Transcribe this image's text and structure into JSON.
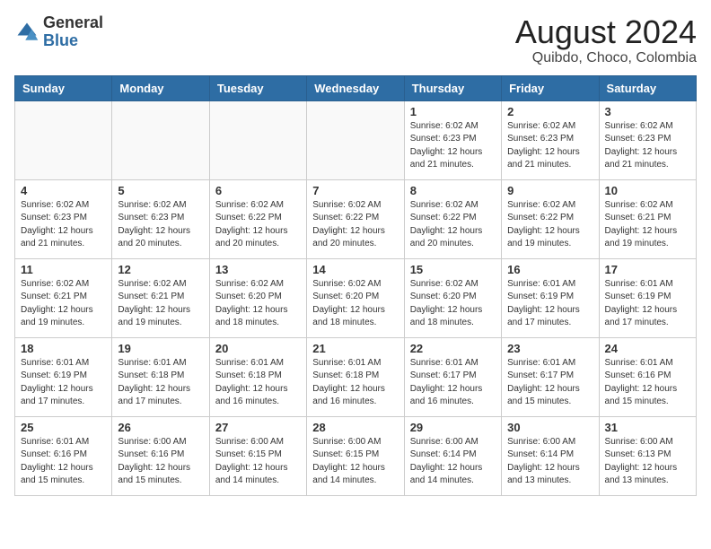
{
  "header": {
    "logo_general": "General",
    "logo_blue": "Blue",
    "month_year": "August 2024",
    "location": "Quibdo, Choco, Colombia"
  },
  "weekdays": [
    "Sunday",
    "Monday",
    "Tuesday",
    "Wednesday",
    "Thursday",
    "Friday",
    "Saturday"
  ],
  "weeks": [
    [
      {
        "day": "",
        "info": ""
      },
      {
        "day": "",
        "info": ""
      },
      {
        "day": "",
        "info": ""
      },
      {
        "day": "",
        "info": ""
      },
      {
        "day": "1",
        "info": "Sunrise: 6:02 AM\nSunset: 6:23 PM\nDaylight: 12 hours\nand 21 minutes."
      },
      {
        "day": "2",
        "info": "Sunrise: 6:02 AM\nSunset: 6:23 PM\nDaylight: 12 hours\nand 21 minutes."
      },
      {
        "day": "3",
        "info": "Sunrise: 6:02 AM\nSunset: 6:23 PM\nDaylight: 12 hours\nand 21 minutes."
      }
    ],
    [
      {
        "day": "4",
        "info": "Sunrise: 6:02 AM\nSunset: 6:23 PM\nDaylight: 12 hours\nand 21 minutes."
      },
      {
        "day": "5",
        "info": "Sunrise: 6:02 AM\nSunset: 6:23 PM\nDaylight: 12 hours\nand 20 minutes."
      },
      {
        "day": "6",
        "info": "Sunrise: 6:02 AM\nSunset: 6:22 PM\nDaylight: 12 hours\nand 20 minutes."
      },
      {
        "day": "7",
        "info": "Sunrise: 6:02 AM\nSunset: 6:22 PM\nDaylight: 12 hours\nand 20 minutes."
      },
      {
        "day": "8",
        "info": "Sunrise: 6:02 AM\nSunset: 6:22 PM\nDaylight: 12 hours\nand 20 minutes."
      },
      {
        "day": "9",
        "info": "Sunrise: 6:02 AM\nSunset: 6:22 PM\nDaylight: 12 hours\nand 19 minutes."
      },
      {
        "day": "10",
        "info": "Sunrise: 6:02 AM\nSunset: 6:21 PM\nDaylight: 12 hours\nand 19 minutes."
      }
    ],
    [
      {
        "day": "11",
        "info": "Sunrise: 6:02 AM\nSunset: 6:21 PM\nDaylight: 12 hours\nand 19 minutes."
      },
      {
        "day": "12",
        "info": "Sunrise: 6:02 AM\nSunset: 6:21 PM\nDaylight: 12 hours\nand 19 minutes."
      },
      {
        "day": "13",
        "info": "Sunrise: 6:02 AM\nSunset: 6:20 PM\nDaylight: 12 hours\nand 18 minutes."
      },
      {
        "day": "14",
        "info": "Sunrise: 6:02 AM\nSunset: 6:20 PM\nDaylight: 12 hours\nand 18 minutes."
      },
      {
        "day": "15",
        "info": "Sunrise: 6:02 AM\nSunset: 6:20 PM\nDaylight: 12 hours\nand 18 minutes."
      },
      {
        "day": "16",
        "info": "Sunrise: 6:01 AM\nSunset: 6:19 PM\nDaylight: 12 hours\nand 17 minutes."
      },
      {
        "day": "17",
        "info": "Sunrise: 6:01 AM\nSunset: 6:19 PM\nDaylight: 12 hours\nand 17 minutes."
      }
    ],
    [
      {
        "day": "18",
        "info": "Sunrise: 6:01 AM\nSunset: 6:19 PM\nDaylight: 12 hours\nand 17 minutes."
      },
      {
        "day": "19",
        "info": "Sunrise: 6:01 AM\nSunset: 6:18 PM\nDaylight: 12 hours\nand 17 minutes."
      },
      {
        "day": "20",
        "info": "Sunrise: 6:01 AM\nSunset: 6:18 PM\nDaylight: 12 hours\nand 16 minutes."
      },
      {
        "day": "21",
        "info": "Sunrise: 6:01 AM\nSunset: 6:18 PM\nDaylight: 12 hours\nand 16 minutes."
      },
      {
        "day": "22",
        "info": "Sunrise: 6:01 AM\nSunset: 6:17 PM\nDaylight: 12 hours\nand 16 minutes."
      },
      {
        "day": "23",
        "info": "Sunrise: 6:01 AM\nSunset: 6:17 PM\nDaylight: 12 hours\nand 15 minutes."
      },
      {
        "day": "24",
        "info": "Sunrise: 6:01 AM\nSunset: 6:16 PM\nDaylight: 12 hours\nand 15 minutes."
      }
    ],
    [
      {
        "day": "25",
        "info": "Sunrise: 6:01 AM\nSunset: 6:16 PM\nDaylight: 12 hours\nand 15 minutes."
      },
      {
        "day": "26",
        "info": "Sunrise: 6:00 AM\nSunset: 6:16 PM\nDaylight: 12 hours\nand 15 minutes."
      },
      {
        "day": "27",
        "info": "Sunrise: 6:00 AM\nSunset: 6:15 PM\nDaylight: 12 hours\nand 14 minutes."
      },
      {
        "day": "28",
        "info": "Sunrise: 6:00 AM\nSunset: 6:15 PM\nDaylight: 12 hours\nand 14 minutes."
      },
      {
        "day": "29",
        "info": "Sunrise: 6:00 AM\nSunset: 6:14 PM\nDaylight: 12 hours\nand 14 minutes."
      },
      {
        "day": "30",
        "info": "Sunrise: 6:00 AM\nSunset: 6:14 PM\nDaylight: 12 hours\nand 13 minutes."
      },
      {
        "day": "31",
        "info": "Sunrise: 6:00 AM\nSunset: 6:13 PM\nDaylight: 12 hours\nand 13 minutes."
      }
    ]
  ]
}
